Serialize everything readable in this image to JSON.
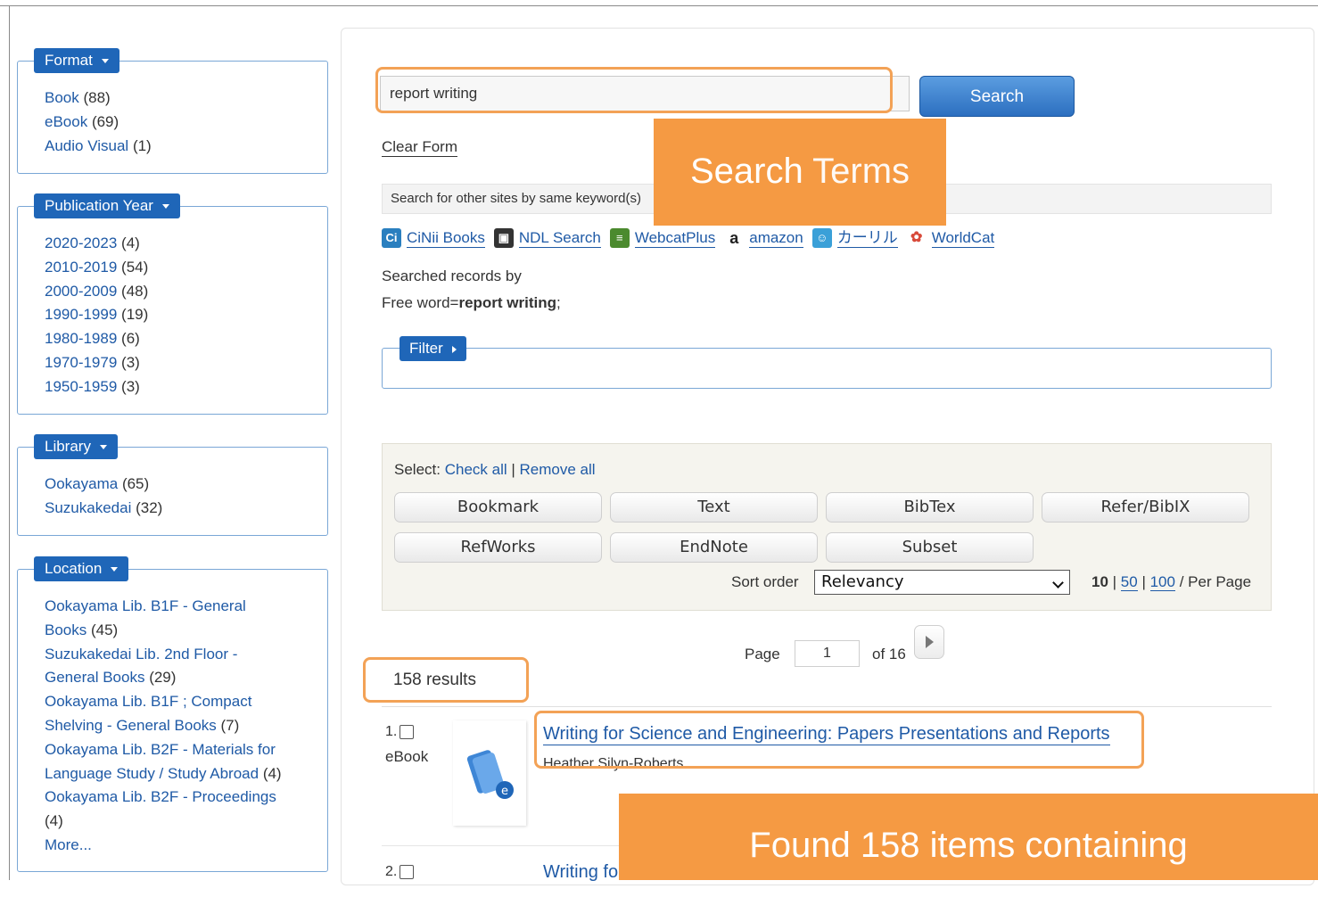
{
  "facets": {
    "format": {
      "title": "Format",
      "items": [
        {
          "label": "Book",
          "count": "(88)"
        },
        {
          "label": "eBook",
          "count": "(69)"
        },
        {
          "label": "Audio Visual",
          "count": "(1)"
        }
      ]
    },
    "year": {
      "title": "Publication Year",
      "items": [
        {
          "label": "2020-2023",
          "count": "(4)"
        },
        {
          "label": "2010-2019",
          "count": "(54)"
        },
        {
          "label": "2000-2009",
          "count": "(48)"
        },
        {
          "label": "1990-1999",
          "count": "(19)"
        },
        {
          "label": "1980-1989",
          "count": "(6)"
        },
        {
          "label": "1970-1979",
          "count": "(3)"
        },
        {
          "label": "1950-1959",
          "count": "(3)"
        }
      ]
    },
    "library": {
      "title": "Library",
      "items": [
        {
          "label": "Ookayama",
          "count": "(65)"
        },
        {
          "label": "Suzukakedai",
          "count": "(32)"
        }
      ]
    },
    "location": {
      "title": "Location",
      "lines": [
        {
          "label": "Ookayama Lib. B1F - General",
          "count": ""
        },
        {
          "label": "Books",
          "count": "(45)"
        },
        {
          "label": "Suzukakedai Lib. 2nd Floor -",
          "count": ""
        },
        {
          "label": "General Books",
          "count": "(29)"
        },
        {
          "label": "Ookayama Lib. B1F ; Compact",
          "count": ""
        },
        {
          "label": "Shelving - General Books",
          "count": "(7)"
        },
        {
          "label": "Ookayama Lib. B2F - Materials for",
          "count": ""
        },
        {
          "label": "Language Study / Study Abroad",
          "count": "(4)"
        },
        {
          "label": "Ookayama Lib. B2F - Proceedings",
          "count": ""
        },
        {
          "label": "",
          "count": "(4)"
        },
        {
          "label": "More...",
          "count": ""
        }
      ]
    }
  },
  "search": {
    "value": "report writing",
    "button": "Search",
    "clear": "Clear Form",
    "other_sites_label": "Search for other sites by same keyword(s)",
    "sites": [
      {
        "label": "CiNii Books",
        "icon": "cinii-icon",
        "icon_text": "Ci",
        "color": "#2a7fbf"
      },
      {
        "label": "NDL Search",
        "icon": "ndl-icon",
        "icon_text": "▣",
        "color": "#333333"
      },
      {
        "label": "WebcatPlus",
        "icon": "webcat-icon",
        "icon_text": "≡",
        "color": "#4b8a2e"
      },
      {
        "label": "amazon",
        "icon": "amazon-icon",
        "icon_text": "a",
        "color": "#222222"
      },
      {
        "label": "カーリル",
        "icon": "calil-icon",
        "icon_text": "☺",
        "color": "#3aa0d8"
      },
      {
        "label": "WorldCat",
        "icon": "worldcat-icon",
        "icon_text": "✿",
        "color": "#d84a3a"
      }
    ],
    "searched_by": "Searched records by",
    "free_word_prefix": "Free word=",
    "free_word_value": "report writing",
    "free_word_suffix": ";"
  },
  "filter": {
    "title": "Filter"
  },
  "tools": {
    "select_label": "Select:",
    "check_all": "Check all",
    "separator": "|",
    "remove_all": "Remove all",
    "buttons_row1": [
      "Bookmark",
      "Text",
      "BibTex",
      "Refer/BibIX"
    ],
    "buttons_row2": [
      "RefWorks",
      "EndNote",
      "Subset"
    ],
    "sort_label": "Sort order",
    "sort_value": "Relevancy",
    "per_page_current": "10",
    "per_page_50": "50",
    "per_page_100": "100",
    "per_page_label": "/ Per Page"
  },
  "pager": {
    "label": "Page",
    "value": "1",
    "of": "of 16"
  },
  "results": {
    "count_text": "158 results",
    "items": [
      {
        "num": "1.",
        "type": "eBook",
        "title": "Writing for Science and Engineering: Papers Presentations and Reports",
        "author": "Heather Silyn-Roberts"
      },
      {
        "num": "2.",
        "title": "Writing fo"
      }
    ]
  },
  "annotations": {
    "search_terms": {
      "strong": "Search",
      "rest": " Terms"
    },
    "found": "Found 158 items containing",
    "color": "#f59a43"
  }
}
